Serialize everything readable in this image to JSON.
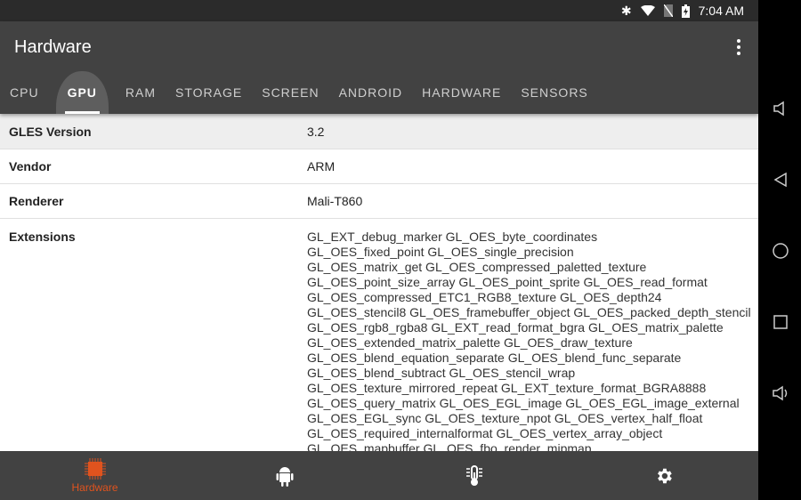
{
  "status": {
    "time": "7:04 AM",
    "icons": [
      "bluetooth-icon",
      "wifi-icon",
      "no-sim-icon",
      "battery-charging-icon"
    ]
  },
  "appbar": {
    "title": "Hardware"
  },
  "tabs": [
    {
      "label": "CPU"
    },
    {
      "label": "GPU",
      "active": true
    },
    {
      "label": "RAM"
    },
    {
      "label": "STORAGE"
    },
    {
      "label": "SCREEN"
    },
    {
      "label": "ANDROID"
    },
    {
      "label": "HARDWARE"
    },
    {
      "label": "SENSORS"
    }
  ],
  "rows": [
    {
      "key": "GLES Version",
      "value": "3.2"
    },
    {
      "key": "Vendor",
      "value": "ARM"
    },
    {
      "key": "Renderer",
      "value": "Mali-T860"
    }
  ],
  "extensions": {
    "key": "Extensions",
    "lines": [
      "GL_EXT_debug_marker GL_OES_byte_coordinates",
      "GL_OES_fixed_point GL_OES_single_precision",
      "GL_OES_matrix_get GL_OES_compressed_paletted_texture",
      "GL_OES_point_size_array GL_OES_point_sprite GL_OES_read_format",
      "GL_OES_compressed_ETC1_RGB8_texture GL_OES_depth24",
      "GL_OES_stencil8 GL_OES_framebuffer_object GL_OES_packed_depth_stencil",
      "GL_OES_rgb8_rgba8 GL_EXT_read_format_bgra GL_OES_matrix_palette",
      "GL_OES_extended_matrix_palette GL_OES_draw_texture",
      "GL_OES_blend_equation_separate GL_OES_blend_func_separate",
      "GL_OES_blend_subtract GL_OES_stencil_wrap",
      "GL_OES_texture_mirrored_repeat GL_EXT_texture_format_BGRA8888",
      "GL_OES_query_matrix GL_OES_EGL_image GL_OES_EGL_image_external",
      "GL_OES_EGL_sync GL_OES_texture_npot GL_OES_vertex_half_float",
      "GL_OES_required_internalformat GL_OES_vertex_array_object",
      "GL_OES_mapbuffer GL_OES_fbo_render_mipmap"
    ]
  },
  "bottom_nav": [
    {
      "label": "Hardware",
      "icon": "chip-icon",
      "active": true
    },
    {
      "icon": "android-icon"
    },
    {
      "icon": "thermometer-icon"
    },
    {
      "icon": "settings-icon"
    }
  ],
  "colors": {
    "accent": "#e0531e",
    "appbar": "#424242"
  }
}
